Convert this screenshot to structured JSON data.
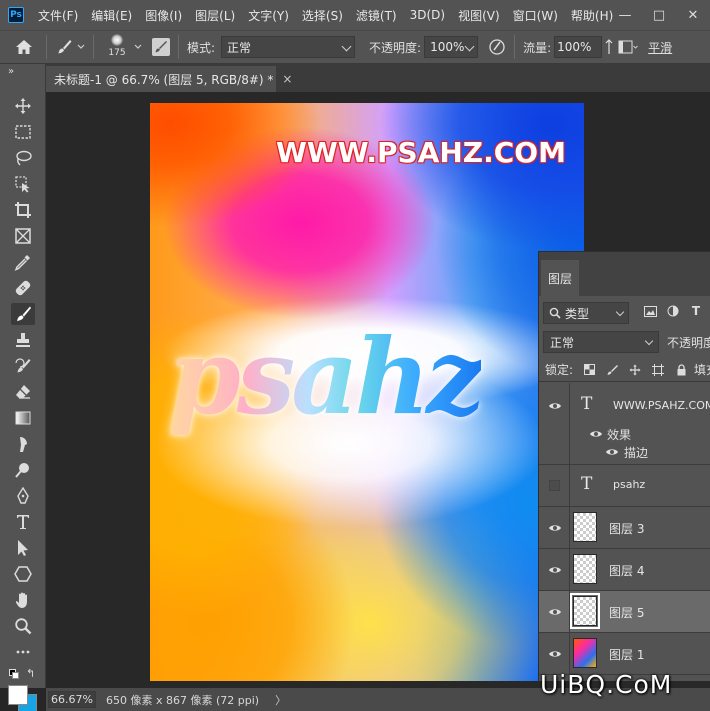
{
  "app": {
    "logo_text": "Ps"
  },
  "menu": [
    "文件(F)",
    "编辑(E)",
    "图像(I)",
    "图层(L)",
    "文字(Y)",
    "选择(S)",
    "滤镜(T)",
    "3D(D)",
    "视图(V)",
    "窗口(W)",
    "帮助(H)"
  ],
  "window_controls": {
    "minimize": "—",
    "maximize": "□",
    "close": "✕"
  },
  "options": {
    "brush_size": "175",
    "mode_label": "模式:",
    "mode_value": "正常",
    "opacity_label": "不透明度:",
    "opacity_value": "100%",
    "flow_label": "流量:",
    "flow_value": "100%",
    "smoothing_label": "平滑"
  },
  "document_tab": {
    "title": "未标题-1 @ 66.7% (图层 5, RGB/8#) *",
    "close": "×"
  },
  "canvas": {
    "top_text": "WWW.PSAHZ.COM",
    "main_text": "psahz"
  },
  "layers_panel": {
    "tab_label": "图层",
    "filter_value": "类型",
    "blend_mode": "正常",
    "opacity_label": "不透明度",
    "lock_label": "锁定:",
    "fill_label": "填充",
    "layers": [
      {
        "name": "WWW.PSAHZ.COM",
        "kind": "text",
        "visible": true,
        "selected": false
      },
      {
        "name": "psahz",
        "kind": "text",
        "visible": false,
        "selected": false
      },
      {
        "name": "图层 3",
        "kind": "pixel",
        "visible": true,
        "selected": false
      },
      {
        "name": "图层 4",
        "kind": "pixel",
        "visible": true,
        "selected": false
      },
      {
        "name": "图层 5",
        "kind": "pixel",
        "visible": true,
        "selected": true
      },
      {
        "name": "图层 1",
        "kind": "image",
        "visible": true,
        "selected": false
      }
    ],
    "effects_label": "效果",
    "stroke_label": "描边"
  },
  "status": {
    "zoom": "66.67%",
    "dimensions": "650 像素 x 867 像素 (72 ppi)",
    "more": "〉"
  },
  "watermark": "UiBQ.CoM"
}
